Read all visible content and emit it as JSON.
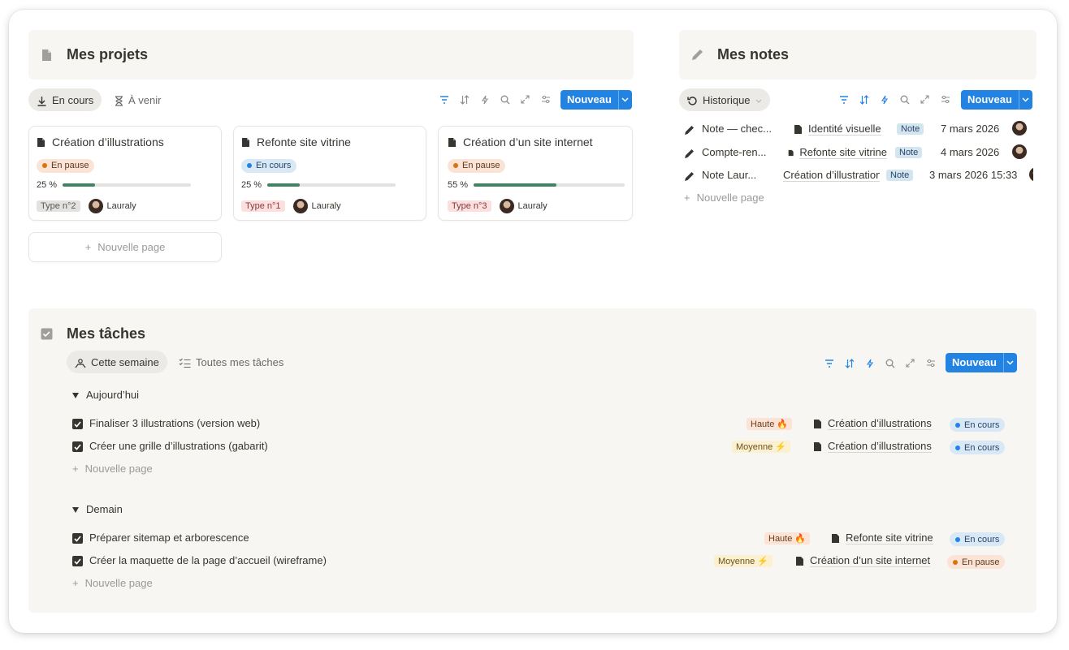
{
  "projects": {
    "title": "Mes projets",
    "tabs": [
      {
        "label": "En cours"
      },
      {
        "label": "À venir"
      }
    ],
    "new_button": "Nouveau",
    "cards": [
      {
        "title": "Création d’illustrations",
        "status": "En pause",
        "progress_label": "25 %",
        "progress": 0.25,
        "type": "Type n°2",
        "owner": "Lauraly"
      },
      {
        "title": "Refonte site vitrine",
        "status": "En cours",
        "progress_label": "25 %",
        "progress": 0.25,
        "type": "Type n°1",
        "owner": "Lauraly"
      },
      {
        "title": "Création d’un site internet",
        "status": "En pause",
        "progress_label": "55 %",
        "progress": 0.55,
        "type": "Type n°3",
        "owner": "Lauraly"
      }
    ],
    "new_page": "Nouvelle page"
  },
  "notes": {
    "title": "Mes notes",
    "tab": "Historique",
    "new_button": "Nouveau",
    "rows": [
      {
        "title": "Note — chec...",
        "project": "Identité visuelle",
        "tag": "Note",
        "date": "7 mars 2026"
      },
      {
        "title": "Compte-ren...",
        "project": "Refonte site vitrine",
        "tag": "Note",
        "date": "4 mars 2026"
      },
      {
        "title": "Note Laur...",
        "project": "Création d’illustrations",
        "tag": "Note",
        "date": "3 mars 2026 15:33"
      }
    ],
    "new_page": "Nouvelle page"
  },
  "tasks": {
    "title": "Mes tâches",
    "tabs": [
      {
        "label": "Cette semaine"
      },
      {
        "label": "Toutes mes tâches"
      }
    ],
    "new_button": "Nouveau",
    "groups": [
      {
        "label": "Aujourd’hui",
        "items": [
          {
            "title": "Finaliser 3 illustrations (version web)",
            "priority": "Haute 🔥",
            "project": "Création d’illustrations",
            "status": "En cours"
          },
          {
            "title": "Créer une grille d’illustrations (gabarit)",
            "priority": "Moyenne ⚡",
            "project": "Création d’illustrations",
            "status": "En cours"
          }
        ],
        "new_page": "Nouvelle page"
      },
      {
        "label": "Demain",
        "items": [
          {
            "title": "Préparer sitemap et arborescence",
            "priority": "Haute 🔥",
            "project": "Refonte site vitrine",
            "status": "En cours"
          },
          {
            "title": "Créer la maquette de la page d’accueil (wireframe)",
            "priority": "Moyenne ⚡",
            "project": "Création d’un site internet",
            "status": "En pause"
          }
        ],
        "new_page": "Nouvelle page"
      }
    ]
  },
  "colors": {
    "accent": "#2383e2",
    "progress": "#448361",
    "panel": "#f7f6f3"
  }
}
